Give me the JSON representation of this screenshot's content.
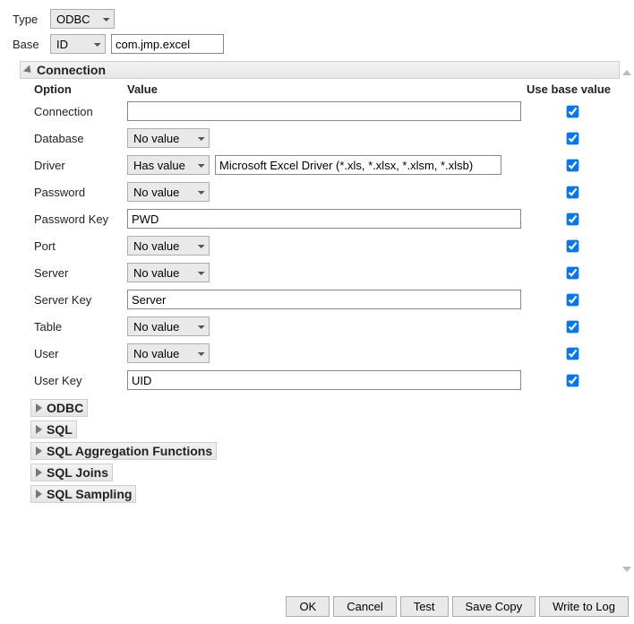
{
  "top": {
    "type_label": "Type",
    "type_value": "ODBC",
    "base_label": "Base",
    "base_sel_value": "ID",
    "base_text": "com.jmp.excel"
  },
  "connection": {
    "title": "Connection",
    "headers": {
      "option": "Option",
      "value": "Value",
      "use_base": "Use base value"
    },
    "rows": {
      "connection": {
        "label": "Connection",
        "input": "",
        "chk": true
      },
      "database": {
        "label": "Database",
        "sel": "No value",
        "chk": true
      },
      "driver": {
        "label": "Driver",
        "sel": "Has value",
        "input": "Microsoft Excel Driver (*.xls, *.xlsx, *.xlsm, *.xlsb)",
        "chk": true
      },
      "password": {
        "label": "Password",
        "sel": "No value",
        "chk": true
      },
      "pwdkey": {
        "label": "Password Key",
        "input": "PWD",
        "chk": true
      },
      "port": {
        "label": "Port",
        "sel": "No value",
        "chk": true
      },
      "server": {
        "label": "Server",
        "sel": "No value",
        "chk": true
      },
      "serverkey": {
        "label": "Server Key",
        "input": "Server",
        "chk": true
      },
      "table": {
        "label": "Table",
        "sel": "No value",
        "chk": true
      },
      "user": {
        "label": "User",
        "sel": "No value",
        "chk": true
      },
      "userkey": {
        "label": "User Key",
        "input": "UID",
        "chk": true
      }
    }
  },
  "sections": {
    "odbc": "ODBC",
    "sql": "SQL",
    "sql_agg": "SQL Aggregation Functions",
    "sql_joins": "SQL Joins",
    "sql_sampling": "SQL Sampling"
  },
  "buttons": {
    "ok": "OK",
    "cancel": "Cancel",
    "test": "Test",
    "save_copy": "Save Copy",
    "write_log": "Write to Log"
  }
}
